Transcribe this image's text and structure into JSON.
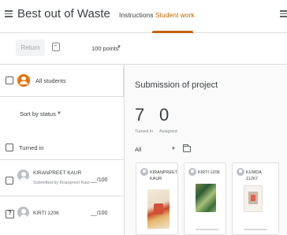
{
  "header": {
    "title": "Best out of Waste",
    "tabs": [
      {
        "label": "Instructions",
        "active": false
      },
      {
        "label": "Student work",
        "active": true
      }
    ]
  },
  "toolbar": {
    "return_label": "Return",
    "points_value": "100 points"
  },
  "roster": {
    "all_students_label": "All students",
    "sort_label": "Sort by status",
    "section_label": "Turned in",
    "students": [
      {
        "name": "KIRANPREET KAUR",
        "status": "Submitted by Kiranpreet Kaur",
        "grade": "__/100"
      },
      {
        "name": "KIRTI 1206",
        "status": "",
        "grade": "__/100"
      }
    ]
  },
  "submission": {
    "title": "Submission of project",
    "turned_in_count": "7",
    "turned_in_label": "Turned in",
    "assigned_count": "0",
    "assigned_label": "Assigned",
    "filter_label": "All",
    "cards": [
      {
        "name": "KIRANPREET KAUR"
      },
      {
        "name": "KIRTI 1206"
      },
      {
        "name": "KUMDA 11267"
      }
    ]
  },
  "colors": {
    "accent": "#c26401",
    "avatar_orange": "#e8710a",
    "divider": "#dadce0"
  },
  "icons": {
    "menu": "menu-icon",
    "apps": "apps-icon",
    "email": "email-icon",
    "folder": "folder-icon"
  }
}
